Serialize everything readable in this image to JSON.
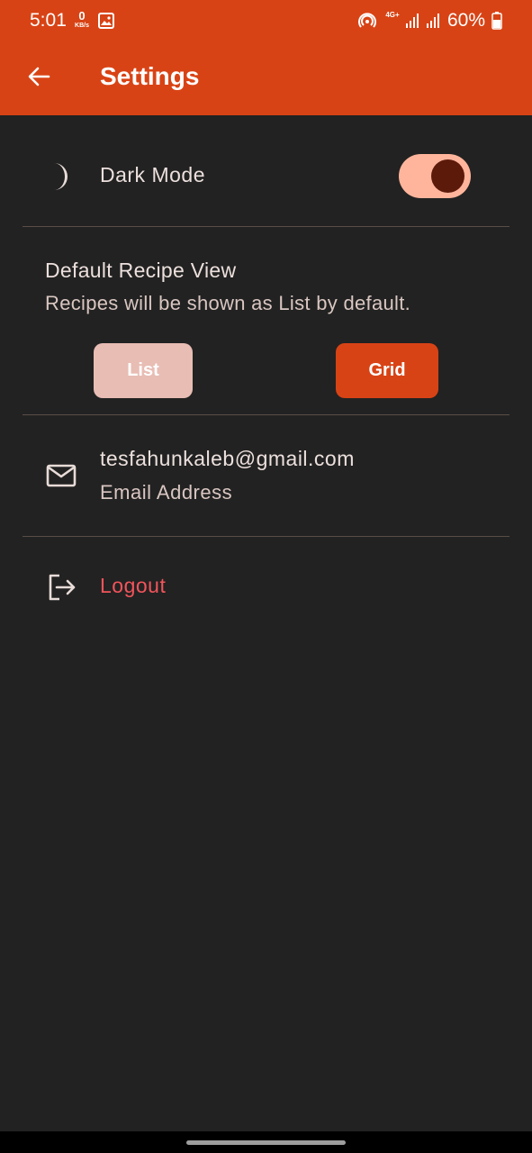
{
  "status_bar": {
    "time": "5:01",
    "speed_value": "0",
    "speed_unit": "KB/s",
    "network_type": "4G+",
    "battery_percent": "60%",
    "icons": [
      "gallery-icon",
      "hotspot-icon",
      "signal-icon",
      "signal-icon",
      "battery-icon"
    ]
  },
  "app_bar": {
    "title": "Settings",
    "back_icon": "arrow-left-icon",
    "background": "#d84315"
  },
  "dark_mode": {
    "label": "Dark Mode",
    "icon": "moon-icon",
    "enabled": true
  },
  "recipe_view": {
    "title": "Default Recipe View",
    "subtitle": "Recipes will be shown as List by default.",
    "list_label": "List",
    "grid_label": "Grid"
  },
  "account": {
    "email": "tesfahunkaleb@gmail.com",
    "email_label": "Email Address",
    "icon": "mail-icon"
  },
  "logout": {
    "label": "Logout",
    "icon": "logout-icon",
    "color": "#f2545b"
  },
  "theme": {
    "background": "#222222",
    "accent": "#d84315",
    "toggle_track": "#ffb59c",
    "toggle_knob": "#5c1a0b"
  }
}
